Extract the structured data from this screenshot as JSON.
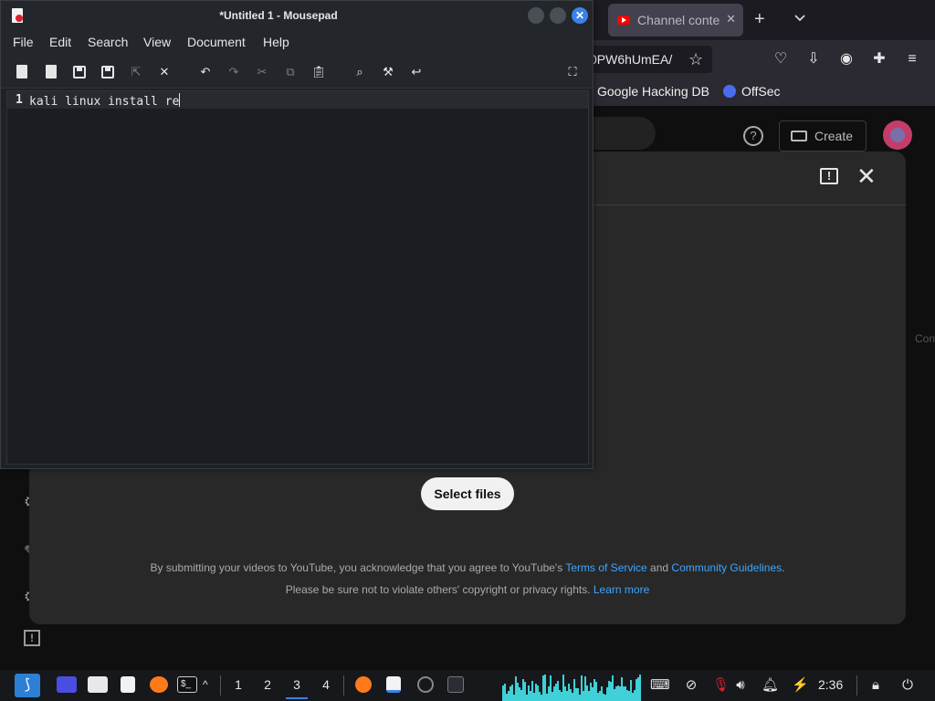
{
  "browser": {
    "tab": {
      "title": "Channel conte",
      "close": "✕"
    },
    "new_tab": "+",
    "url_text": "0PW6hUmEA/",
    "bookmarks": [
      "Google Hacking DB",
      "OffSec"
    ],
    "youtube": {
      "create_label": "Create",
      "help_glyph": "?",
      "right_edge_text": "Con",
      "dialog": {
        "select_files_label": "Select files",
        "legal_line1_prefix": "By submitting your videos to YouTube, you acknowledge that you agree to YouTube's ",
        "terms_link": "Terms of Service",
        "legal_line1_mid": " and ",
        "guidelines_link": "Community Guidelines",
        "legal_line1_suffix": ".",
        "legal_line2_prefix": "Please be sure not to violate others' copyright or privacy rights. ",
        "learn_more_link": "Learn more",
        "feedback_glyph": "!",
        "close_glyph": "✕"
      }
    }
  },
  "mousepad": {
    "title": "*Untitled 1 - Mousepad",
    "menu": [
      "File",
      "Edit",
      "Search",
      "View",
      "Document",
      "Help"
    ],
    "editor": {
      "line_number": "1",
      "text": "kali linux install re"
    }
  },
  "taskbar": {
    "workspaces": [
      "1",
      "2",
      "3",
      "4"
    ],
    "active_workspace": "3",
    "clock": "2:36",
    "accent": "#3b82e6"
  }
}
